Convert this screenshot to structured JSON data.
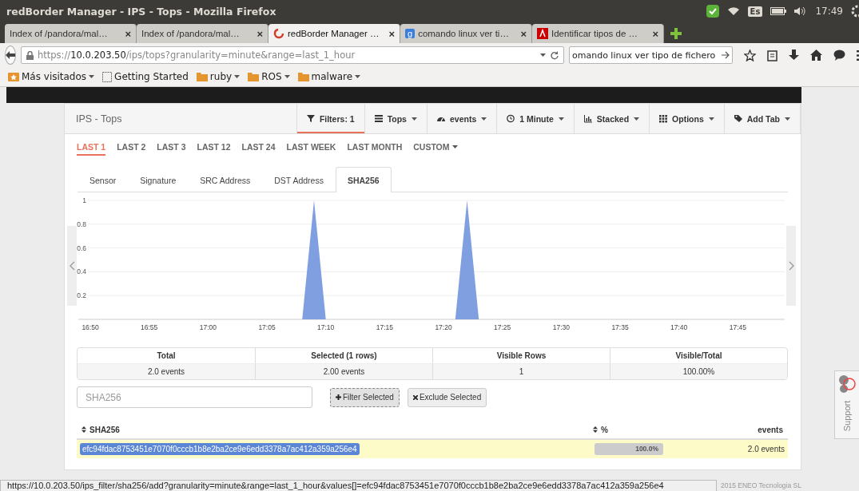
{
  "window": {
    "title": "redBorder Manager - IPS - Tops - Mozilla Firefox"
  },
  "tray": {
    "keyboard": "Es",
    "clock": "17:49"
  },
  "browser_tabs": [
    {
      "label": "Index of /pandora/mal…",
      "close": "×",
      "selected": false,
      "kind": "plain"
    },
    {
      "label": "Index of /pandora/mal…",
      "close": "×",
      "selected": false,
      "kind": "plain"
    },
    {
      "label": "redBorder Manager …",
      "close": "×",
      "selected": true,
      "kind": "spiral"
    },
    {
      "label": "comando linux ver ti…",
      "close": "×",
      "selected": false,
      "kind": "letter",
      "badge": "g"
    },
    {
      "label": "Identificar tipos de …",
      "close": "×",
      "selected": false,
      "kind": "red"
    }
  ],
  "address_bar": {
    "scheme": "https://",
    "host": "10.0.203.50",
    "path": "/ips/tops?granularity=minute&range=last_1_hour"
  },
  "search_field": {
    "value": "omando linux ver tipo de fichero"
  },
  "bookmarks": [
    {
      "label": "Más visitados",
      "menu": true,
      "kind": "star"
    },
    {
      "label": "Getting Started",
      "menu": false,
      "kind": "page"
    },
    {
      "label": "ruby",
      "menu": true,
      "kind": "folder"
    },
    {
      "label": "ROS",
      "menu": true,
      "kind": "folder"
    },
    {
      "label": "malware",
      "menu": true,
      "kind": "folder"
    }
  ],
  "panel": {
    "title": "IPS - Tops",
    "toolbar": [
      {
        "label": "Filters: 1",
        "selected": true,
        "menu": false,
        "kind": "filter"
      },
      {
        "label": "Tops",
        "selected": false,
        "menu": true,
        "kind": "list"
      },
      {
        "label": "events",
        "selected": false,
        "menu": true,
        "kind": "gauge"
      },
      {
        "label": "1 Minute",
        "selected": false,
        "menu": true,
        "kind": "clock"
      },
      {
        "label": "Stacked",
        "selected": false,
        "menu": true,
        "kind": "bars"
      },
      {
        "label": "Options",
        "selected": false,
        "menu": true,
        "kind": "grid"
      },
      {
        "label": "Add Tab",
        "selected": false,
        "menu": true,
        "kind": "tag"
      }
    ],
    "ranges": [
      {
        "label": "LAST 1",
        "selected": true,
        "menu": false
      },
      {
        "label": "LAST 2",
        "selected": false,
        "menu": false
      },
      {
        "label": "LAST 3",
        "selected": false,
        "menu": false
      },
      {
        "label": "LAST 12",
        "selected": false,
        "menu": false
      },
      {
        "label": "LAST 24",
        "selected": false,
        "menu": false
      },
      {
        "label": "LAST WEEK",
        "selected": false,
        "menu": false
      },
      {
        "label": "LAST MONTH",
        "selected": false,
        "menu": false
      },
      {
        "label": "CUSTOM",
        "selected": false,
        "menu": true
      }
    ],
    "tabs": [
      {
        "label": "Sensor",
        "selected": false
      },
      {
        "label": "Signature",
        "selected": false
      },
      {
        "label": "SRC Address",
        "selected": false
      },
      {
        "label": "DST Address",
        "selected": false
      },
      {
        "label": "SHA256",
        "selected": true
      }
    ],
    "chart_data": {
      "type": "area",
      "x": [
        1009,
        1028,
        1029,
        1030,
        1041,
        1042,
        1043,
        1069
      ],
      "series": [
        {
          "color": "#7f9fe0",
          "values": [
            0,
            0,
            1,
            0,
            0,
            1,
            0,
            0
          ]
        }
      ],
      "grid": true,
      "xlim": [
        1009,
        1069
      ],
      "ylim": [
        0,
        1
      ],
      "xticks": [
        {
          "value": 1010,
          "label": "16:50"
        },
        {
          "value": 1015,
          "label": "16:55"
        },
        {
          "value": 1020,
          "label": "17:00"
        },
        {
          "value": 1025,
          "label": "17:05"
        },
        {
          "value": 1030,
          "label": "17:10"
        },
        {
          "value": 1035,
          "label": "17:15"
        },
        {
          "value": 1040,
          "label": "17:20"
        },
        {
          "value": 1045,
          "label": "17:25"
        },
        {
          "value": 1050,
          "label": "17:30"
        },
        {
          "value": 1055,
          "label": "17:35"
        },
        {
          "value": 1060,
          "label": "17:40"
        },
        {
          "value": 1065,
          "label": "17:45"
        }
      ],
      "yticks": [
        0.2,
        0.4,
        0.6,
        0.8,
        1
      ]
    },
    "summary": [
      {
        "header": "Total",
        "value": "2.0 events"
      },
      {
        "header": "Selected (1 rows)",
        "value": "2.00 events"
      },
      {
        "header": "Visible Rows",
        "value": "1"
      },
      {
        "header": "Visible/Total",
        "value": "100.00%"
      }
    ],
    "filter_field": {
      "placeholder": "SHA256"
    },
    "actions": [
      {
        "label": "Filter Selected",
        "focused": true,
        "kind": "plus"
      },
      {
        "label": "Exclude Selected",
        "focused": false,
        "kind": "cross"
      }
    ],
    "table": {
      "columns": [
        {
          "label": "SHA256",
          "sortable": true
        },
        {
          "label": "%",
          "sortable": true
        },
        {
          "label": "events",
          "sortable": false
        }
      ],
      "rows": [
        {
          "hash": "efc94fdac8753451e7070f0cccb1b8e2ba2ce9e6edd3378a7ac412a359a256e4",
          "selected": true,
          "level": 1,
          "percent": "100.0%",
          "events": "2.0 events"
        }
      ]
    }
  },
  "status_url": "https://10.0.203.50/ips_filter/sha256/add?granularity=minute&range=last_1_hour&values[]=efc94fdac8753451e7070f0cccb1b8e2ba2ce9e6edd3378a7ac412a359a256e4",
  "footer": "2015 ENEO Tecnologia SL",
  "support": {
    "label": "Support"
  }
}
